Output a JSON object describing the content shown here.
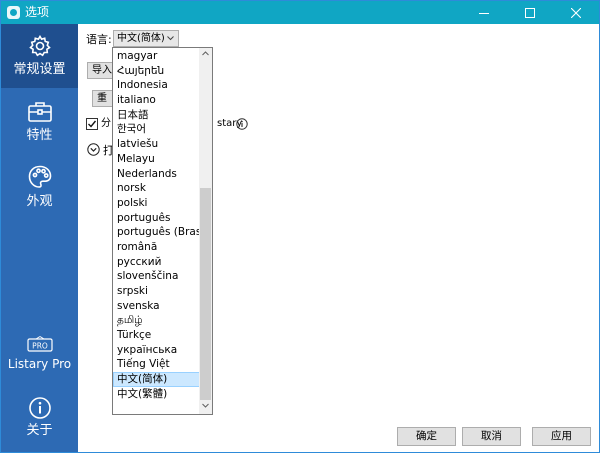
{
  "window": {
    "title": "选项"
  },
  "sidebar": {
    "items": [
      {
        "label": "常规设置",
        "icon": "gear-icon"
      },
      {
        "label": "特性",
        "icon": "toolbox-icon"
      },
      {
        "label": "外观",
        "icon": "palette-icon"
      },
      {
        "label": "Listary Pro",
        "icon": "pro-badge-icon",
        "badge": "PRO"
      },
      {
        "label": "关于",
        "icon": "info-icon"
      }
    ]
  },
  "general": {
    "language_label": "语言:",
    "language_value": "中文(简体)",
    "import_label": "导入",
    "reset_label": "重置",
    "checkbox_label": "分",
    "checkbox_label_tail": "stary",
    "checkbox_checked": true,
    "expand_label": "打"
  },
  "language_options": [
    "magyar",
    "Հայերեն",
    "Indonesia",
    "italiano",
    "日本語",
    "한국어",
    "latviešu",
    "Melayu",
    "Nederlands",
    "norsk",
    "polski",
    "português",
    "português (Brasil)",
    "română",
    "русский",
    "slovenščina",
    "srpski",
    "svenska",
    "தமிழ்",
    "Türkçe",
    "українська",
    "Tiếng Việt",
    "中文(简体)",
    "中文(繁體)"
  ],
  "selected_language_index": 22,
  "footer": {
    "ok_label": "确定",
    "cancel_label": "取消",
    "apply_label": "应用"
  },
  "colors": {
    "titlebar": "#10a6c4",
    "sidebar": "#2d6ab4",
    "sidebar_active": "#1f4f8f",
    "selection": "#cce8ff"
  }
}
